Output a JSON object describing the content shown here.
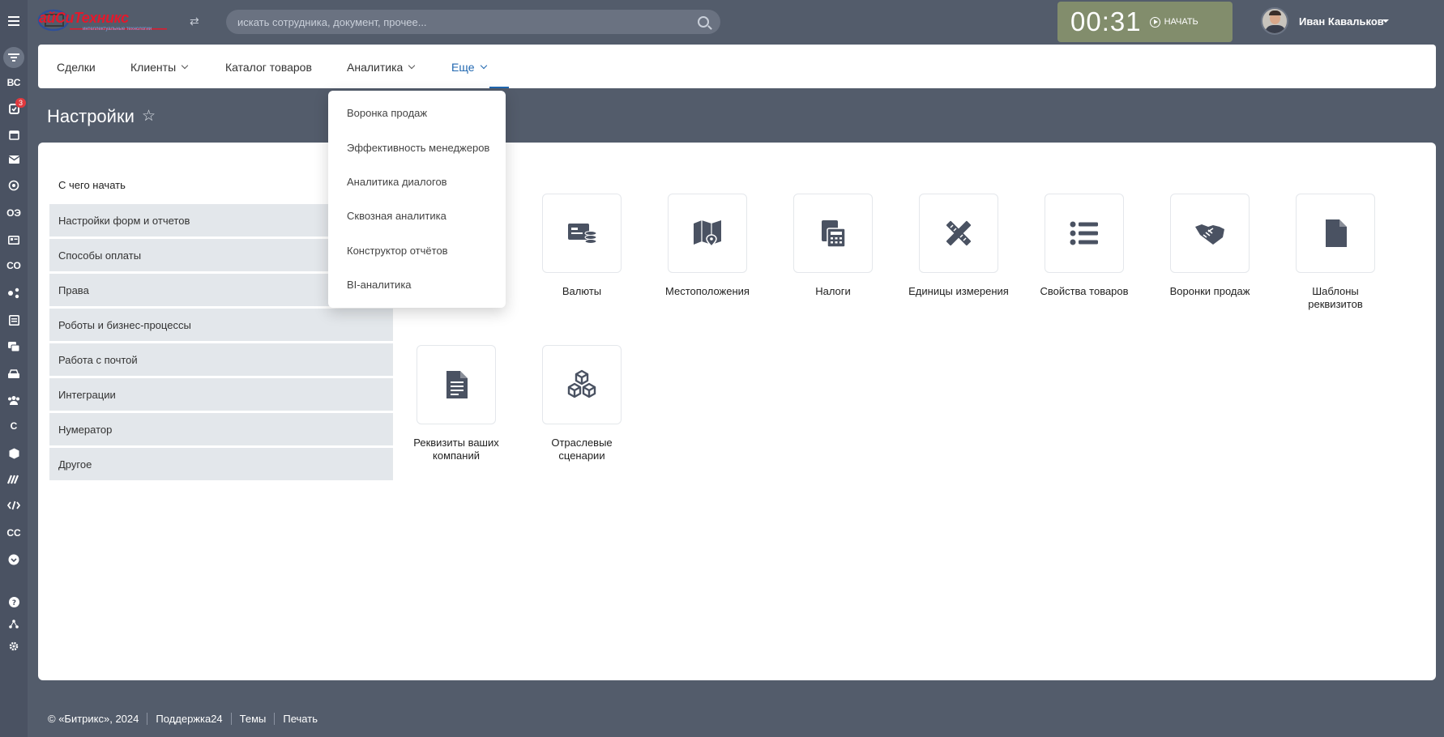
{
  "header": {
    "logo_text": "айСиТехникс",
    "logo_sub": "интеллектуальные технологии",
    "search_placeholder": "искать сотрудника, документ, прочее...",
    "timer": {
      "time": "00:31",
      "start_label": "НАЧАТЬ"
    },
    "user_name": "Иван Кавальков"
  },
  "rail": {
    "items": [
      "ВС",
      "ОЭ",
      "СО",
      "С",
      "СС"
    ],
    "badge": "3"
  },
  "nav": {
    "items": [
      "Сделки",
      "Клиенты",
      "Каталог товаров",
      "Аналитика",
      "Еще"
    ]
  },
  "dropdown": {
    "items": [
      "Воронка продаж",
      "Эффективность менеджеров",
      "Аналитика диалогов",
      "Сквозная аналитика",
      "Конструктор отчётов",
      "BI-аналитика"
    ]
  },
  "page": {
    "title": "Настройки"
  },
  "sidebar": {
    "heading": "С чего начать",
    "items": [
      "Настройки форм и отчетов",
      "Способы оплаты",
      "Права",
      "Роботы и бизнес-процессы",
      "Работа с почтой",
      "Интеграции",
      "Нумератор",
      "Другое"
    ]
  },
  "tiles": [
    {
      "label": "Валюты",
      "icon": "currency-icon"
    },
    {
      "label": "Местоположения",
      "icon": "map-pin-icon"
    },
    {
      "label": "Налоги",
      "icon": "calculator-icon"
    },
    {
      "label": "Единицы измерения",
      "icon": "ruler-pencil-icon"
    },
    {
      "label": "Свойства товаров",
      "icon": "list-icon"
    },
    {
      "label": "Воронки продаж",
      "icon": "handshake-icon"
    },
    {
      "label": "Шаблоны реквизитов",
      "icon": "file-icon"
    },
    {
      "label": "Реквизиты ваших компаний",
      "icon": "document-icon"
    },
    {
      "label": "Отраслевые сценарии",
      "icon": "cubes-icon"
    }
  ],
  "footer": {
    "copyright": "© «Битрикс», 2024",
    "support": "Поддержка24",
    "themes": "Темы",
    "print": "Печать"
  },
  "colors": {
    "background": "#535c6b",
    "rail": "#4a5262",
    "timer": "#828d6c",
    "accent": "#2067b0",
    "sidebar_item": "#e3e7eb",
    "icon": "#4a5262"
  }
}
